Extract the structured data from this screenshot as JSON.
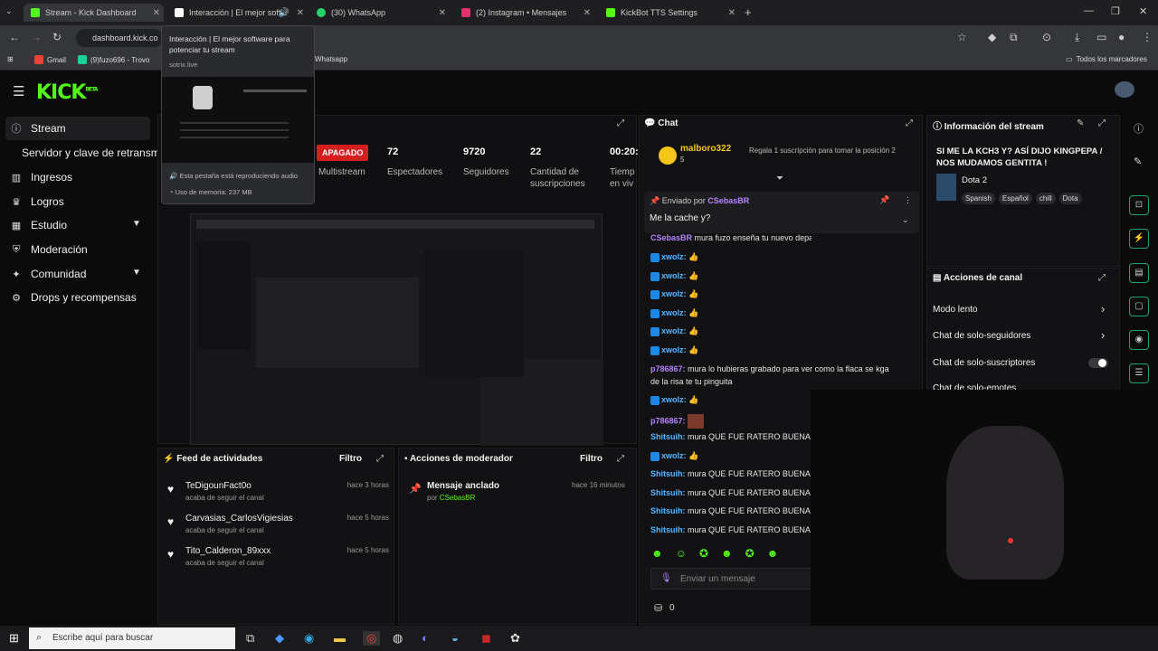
{
  "browser": {
    "tabs": [
      {
        "label": "Stream - Kick Dashboard",
        "color": "#53fc18"
      },
      {
        "label": "Interacción | El mejor softw",
        "color": "#ffffff"
      },
      {
        "label": "(30) WhatsApp",
        "color": "#25d366"
      },
      {
        "label": "(2) Instagram • Mensajes",
        "color": "#e1306c"
      },
      {
        "label": "KickBot TTS Settings",
        "color": "#53fc18"
      }
    ],
    "url": "dashboard.kick.co",
    "bookmarks": [
      {
        "label": "Gmail"
      },
      {
        "label": "(9)fuzo696 - Trovo"
      },
      {
        "label": "Whatsapp"
      }
    ],
    "all_bookmarks": "Todos los marcadores"
  },
  "tooltip": {
    "title": "Interacción | El mejor software para potenciar tu stream",
    "domain": "sotrix.live",
    "audio": "Esta pestaña está reproduciendo audio",
    "memory": "Uso de memoria: 237 MB"
  },
  "logo": "KICK",
  "logo_sup": "BETA",
  "sidebar": {
    "items": [
      {
        "label": "Stream",
        "icon": "info-icon"
      },
      {
        "label": "Servidor y clave de retransmi"
      },
      {
        "label": "Ingresos",
        "icon": "bar-chart-icon"
      },
      {
        "label": "Logros",
        "icon": "trophy-icon"
      },
      {
        "label": "Estudio",
        "icon": "grid-icon"
      },
      {
        "label": "Moderación",
        "icon": "shield-icon"
      },
      {
        "label": "Comunidad",
        "icon": "community-icon"
      },
      {
        "label": "Drops y recompensas",
        "icon": "drops-icon"
      }
    ]
  },
  "stats": {
    "status": "APAGADO",
    "items": [
      {
        "value": "",
        "label": "Multistream"
      },
      {
        "value": "72",
        "label": "Espectadores"
      },
      {
        "value": "9720",
        "label": "Seguidores"
      },
      {
        "value": "22",
        "label": "Cantidad de suscripciones"
      },
      {
        "value": "00:20:",
        "label": "Tiemp en viv"
      }
    ]
  },
  "feed": {
    "title": "Feed de actividades",
    "filter": "Filtro",
    "items": [
      {
        "name": "TeDigounFact0o",
        "sub": "acaba de seguir el canal",
        "time": "hace 3 horas"
      },
      {
        "name": "Carvasias_CarlosVigiesias",
        "sub": "acaba de seguir el canal",
        "time": "hace 5 horas"
      },
      {
        "name": "Tito_Calderon_89xxx",
        "sub": "acaba de seguir el canal",
        "time": "hace 5 horas"
      }
    ]
  },
  "modactions": {
    "title": "Acciones de moderador",
    "filter": "Filtro",
    "item": {
      "title": "Mensaje anclado",
      "by": "por",
      "user": "CSebasBR",
      "time": "hace 16 minutos"
    }
  },
  "chat": {
    "title": "Chat",
    "gift": {
      "user": "malboro322",
      "count": "5",
      "text": "Regala 1 suscripción para tomar la posición 2"
    },
    "pinned": {
      "by_label": "Enviado por",
      "user": "CSebasBR",
      "text": "Me la cache y?"
    },
    "lines": [
      {
        "user": "CSebasBR",
        "text": "mura fuzo enseña tu nuevo depa mrd",
        "color": "purple"
      },
      {
        "user": "xwolz:",
        "text": "👍",
        "color": "blue"
      },
      {
        "user": "xwolz:",
        "text": "👍",
        "color": "blue"
      },
      {
        "user": "xwolz:",
        "text": "👍",
        "color": "blue"
      },
      {
        "user": "xwolz:",
        "text": "👍",
        "color": "blue"
      },
      {
        "user": "xwolz:",
        "text": "👍",
        "color": "blue"
      },
      {
        "user": "xwolz:",
        "text": "👍",
        "color": "blue"
      },
      {
        "user": "p786867:",
        "text": "mura lo hubieras grabado para ver como la flaca se kga",
        "color": "purple"
      },
      {
        "user": "",
        "text": "de la risa te tu pinguita",
        "color": "none"
      },
      {
        "user": "xwolz:",
        "text": "👍",
        "color": "blue"
      },
      {
        "user": "p786867:",
        "text": "",
        "color": "purple"
      },
      {
        "user": "Shitsuih:",
        "text": "mura QUE FUE RATERO BUENAS",
        "color": "blue"
      },
      {
        "user": "xwolz:",
        "text": "👍",
        "color": "blue"
      },
      {
        "user": "Shitsuih:",
        "text": "mura QUE FUE RATERO BUENAS",
        "color": "blue"
      },
      {
        "user": "Shitsuih:",
        "text": "mura QUE FUE RATERO BUENAS",
        "color": "blue"
      },
      {
        "user": "Shitsuih:",
        "text": "mura QUE FUE RATERO BUENAS",
        "color": "blue"
      },
      {
        "user": "Shitsuih:",
        "text": "mura QUE FUE RATERO BUENAS",
        "color": "blue"
      }
    ],
    "input_placeholder": "Enviar un mensaje",
    "points": "0"
  },
  "streaminfo": {
    "title": "Información del stream",
    "stream_title": "SI ME LA KCH3 Y? ASÍ DIJO KINGPEPA / NOS MUDAMOS GENTITA !",
    "game": "Dota 2",
    "tags": [
      "Spanish",
      "Español",
      "chill",
      "Dota"
    ]
  },
  "channel_actions": {
    "title": "Acciones de canal",
    "items": [
      {
        "label": "Modo lento",
        "kind": "arrow"
      },
      {
        "label": "Chat de solo-seguidores",
        "kind": "arrow"
      },
      {
        "label": "Chat de solo-suscriptores",
        "kind": "toggle"
      },
      {
        "label": "Chat de solo-emotes",
        "kind": "toggle"
      }
    ]
  },
  "taskbar": {
    "search_placeholder": "Escribe aquí para buscar"
  },
  "colors": {
    "kick_green": "#53fc18",
    "apagado_red": "#d31f1f",
    "username_blue": "#55b6ff",
    "username_purple": "#b685ff"
  }
}
